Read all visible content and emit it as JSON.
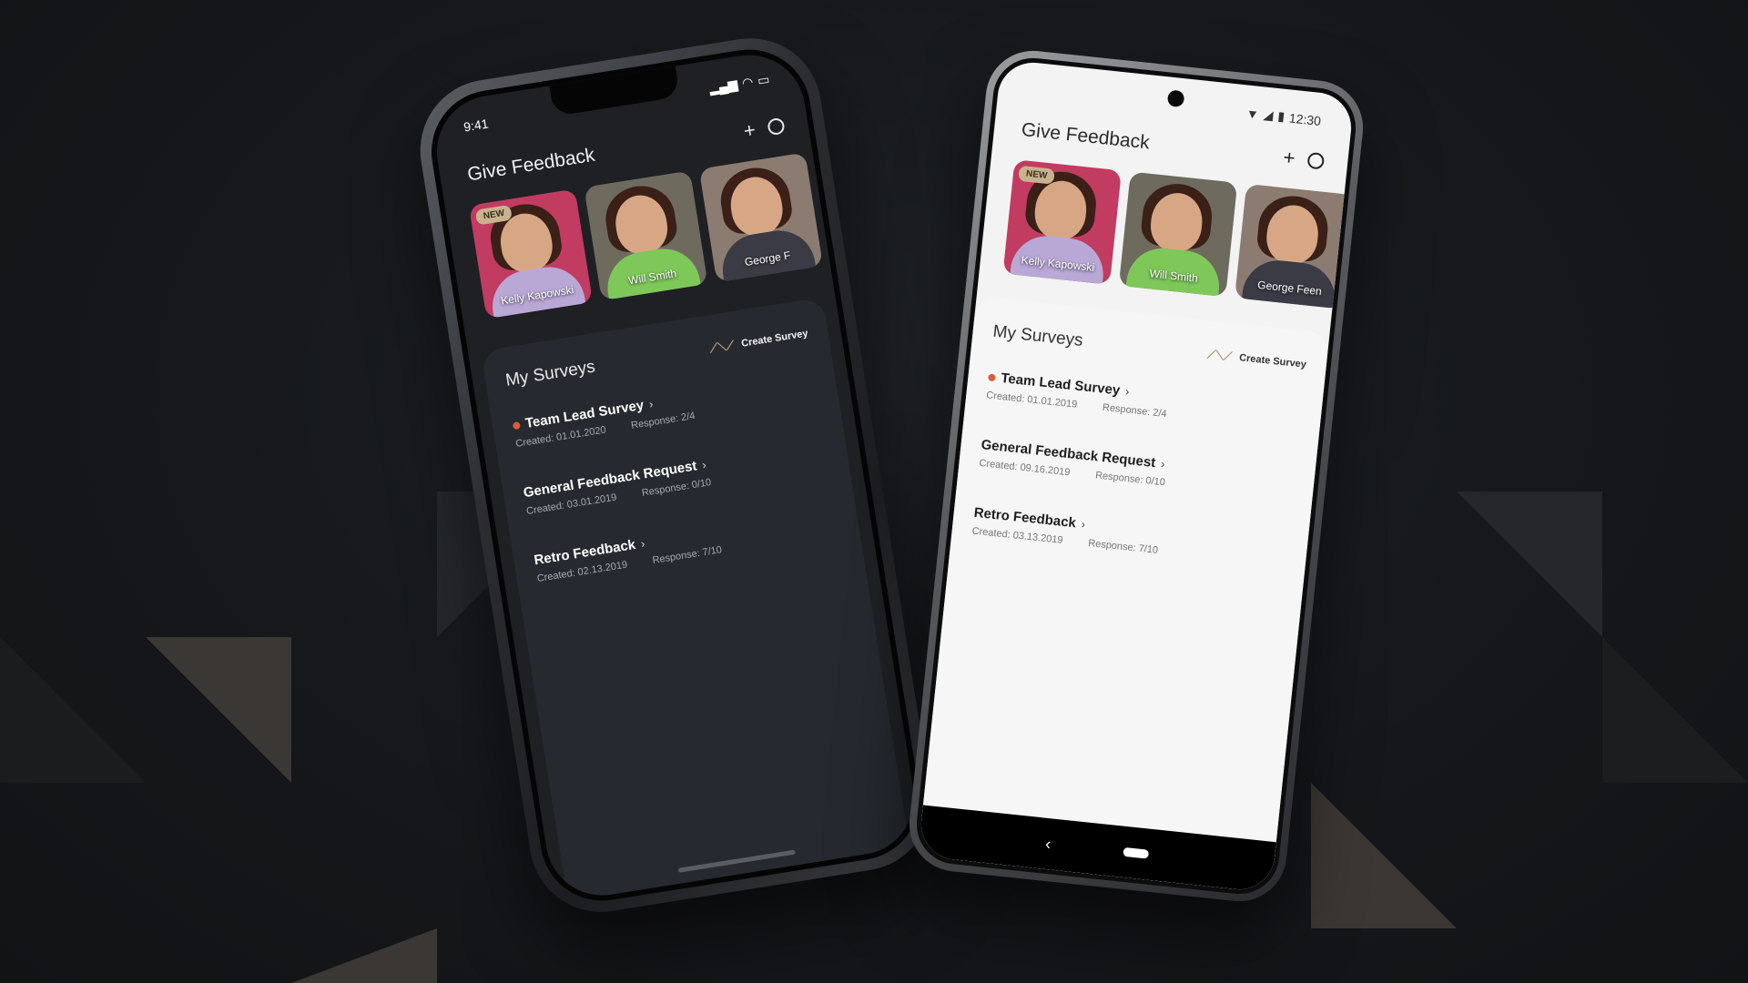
{
  "iphone": {
    "status_time": "9:41",
    "title": "Give Feedback",
    "add_icon": "plus-icon",
    "profile_icon": "user-circle-icon",
    "cards": [
      {
        "name": "Kelly Kapowski",
        "badge": "NEW",
        "bg": "#c23b60",
        "body": "#b9a8d6"
      },
      {
        "name": "Will Smith",
        "badge": "",
        "bg": "#6f6a5e",
        "body": "#7ec85a"
      },
      {
        "name": "George F",
        "badge": "",
        "bg": "#8c7b70",
        "body": "#3a3b44"
      }
    ],
    "surveys_title": "My Surveys",
    "create_label": "Create Survey",
    "surveys": [
      {
        "name": "Team Lead Survey",
        "created": "Created: 01.01.2020",
        "response": "Response: 2/4",
        "new": true
      },
      {
        "name": "General Feedback Request",
        "created": "Created: 03.01.2019",
        "response": "Response: 0/10",
        "new": false
      },
      {
        "name": "Retro Feedback",
        "created": "Created: 02.13.2019",
        "response": "Response: 7/10",
        "new": false
      }
    ]
  },
  "android": {
    "status_time": "12:30",
    "title": "Give Feedback",
    "add_icon": "plus-icon",
    "profile_icon": "user-circle-icon",
    "cards": [
      {
        "name": "Kelly Kapowski",
        "badge": "NEW",
        "bg": "#c23b60",
        "body": "#b9a8d6"
      },
      {
        "name": "Will Smith",
        "badge": "",
        "bg": "#6f6a5e",
        "body": "#7ec85a"
      },
      {
        "name": "George Feen",
        "badge": "",
        "bg": "#8c7b70",
        "body": "#3a3b44"
      }
    ],
    "surveys_title": "My Surveys",
    "create_label": "Create Survey",
    "surveys": [
      {
        "name": "Team Lead Survey",
        "created": "Created: 01.01.2019",
        "response": "Response: 2/4",
        "new": true
      },
      {
        "name": "General Feedback Request",
        "created": "Created: 09.16.2019",
        "response": "Response: 0/10",
        "new": false
      },
      {
        "name": "Retro Feedback",
        "created": "Created: 03.13.2019",
        "response": "Response: 7/10",
        "new": false
      }
    ]
  },
  "colors": {
    "accent": "#b39a76",
    "badge": "#c9b38f",
    "new_dot": "#e05a3a",
    "dark_screen": "#1e2024",
    "light_screen": "#f3f3f3"
  }
}
